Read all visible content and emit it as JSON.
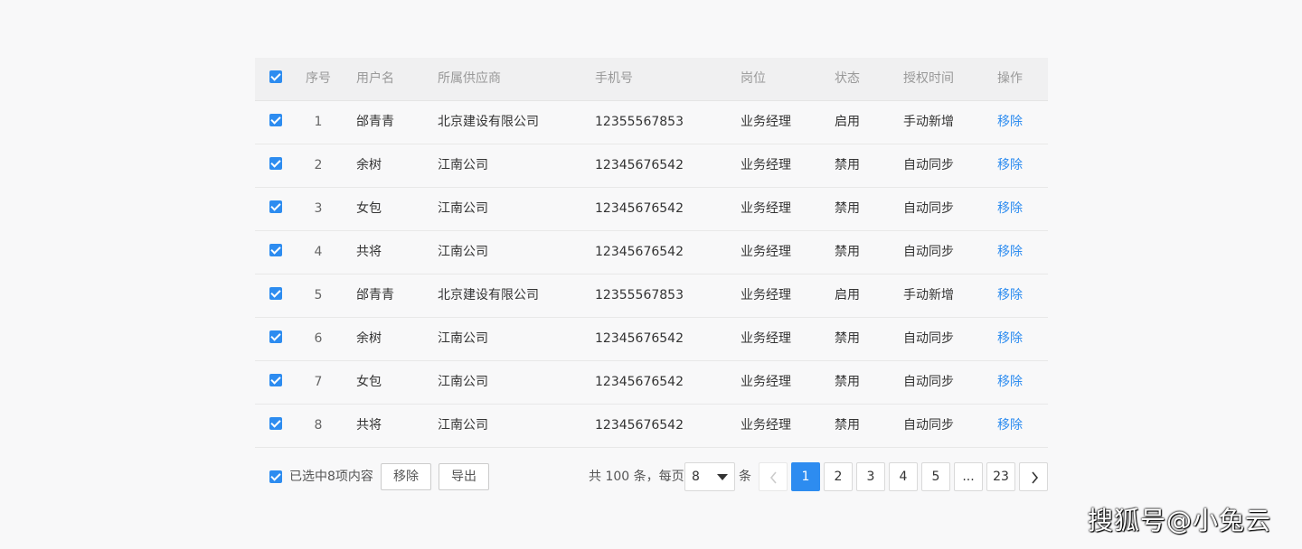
{
  "table": {
    "headers": {
      "index": "序号",
      "username": "用户名",
      "supplier": "所属供应商",
      "phone": "手机号",
      "role": "岗位",
      "status": "状态",
      "auth_time": "授权时间",
      "operation": "操作"
    },
    "rows": [
      {
        "index": "1",
        "username": "邰青青",
        "supplier": "北京建设有限公司",
        "phone": "12355567853",
        "role": "业务经理",
        "status": "启用",
        "auth_time": "手动新增",
        "operation": "移除"
      },
      {
        "index": "2",
        "username": "余树",
        "supplier": "江南公司",
        "phone": "12345676542",
        "role": "业务经理",
        "status": "禁用",
        "auth_time": "自动同步",
        "operation": "移除"
      },
      {
        "index": "3",
        "username": "女包",
        "supplier": "江南公司",
        "phone": "12345676542",
        "role": "业务经理",
        "status": "禁用",
        "auth_time": "自动同步",
        "operation": "移除"
      },
      {
        "index": "4",
        "username": "共将",
        "supplier": "江南公司",
        "phone": "12345676542",
        "role": "业务经理",
        "status": "禁用",
        "auth_time": "自动同步",
        "operation": "移除"
      },
      {
        "index": "5",
        "username": "邰青青",
        "supplier": "北京建设有限公司",
        "phone": "12355567853",
        "role": "业务经理",
        "status": "启用",
        "auth_time": "手动新增",
        "operation": "移除"
      },
      {
        "index": "6",
        "username": "余树",
        "supplier": "江南公司",
        "phone": "12345676542",
        "role": "业务经理",
        "status": "禁用",
        "auth_time": "自动同步",
        "operation": "移除"
      },
      {
        "index": "7",
        "username": "女包",
        "supplier": "江南公司",
        "phone": "12345676542",
        "role": "业务经理",
        "status": "禁用",
        "auth_time": "自动同步",
        "operation": "移除"
      },
      {
        "index": "8",
        "username": "共将",
        "supplier": "江南公司",
        "phone": "12345676542",
        "role": "业务经理",
        "status": "禁用",
        "auth_time": "自动同步",
        "operation": "移除"
      }
    ]
  },
  "footer": {
    "selected_text": "已选中8项内容",
    "remove_button": "移除",
    "export_button": "导出",
    "total_text": "共 100 条，每页",
    "page_size": "8",
    "unit_text": "条",
    "pages": [
      "1",
      "2",
      "3",
      "4",
      "5",
      "...",
      "23"
    ],
    "current_page": "1"
  },
  "watermark": "搜狐号@小兔云",
  "colors": {
    "accent": "#2d8cf0",
    "header_bg": "#f0f0f1",
    "page_bg": "#f8f8f9"
  }
}
